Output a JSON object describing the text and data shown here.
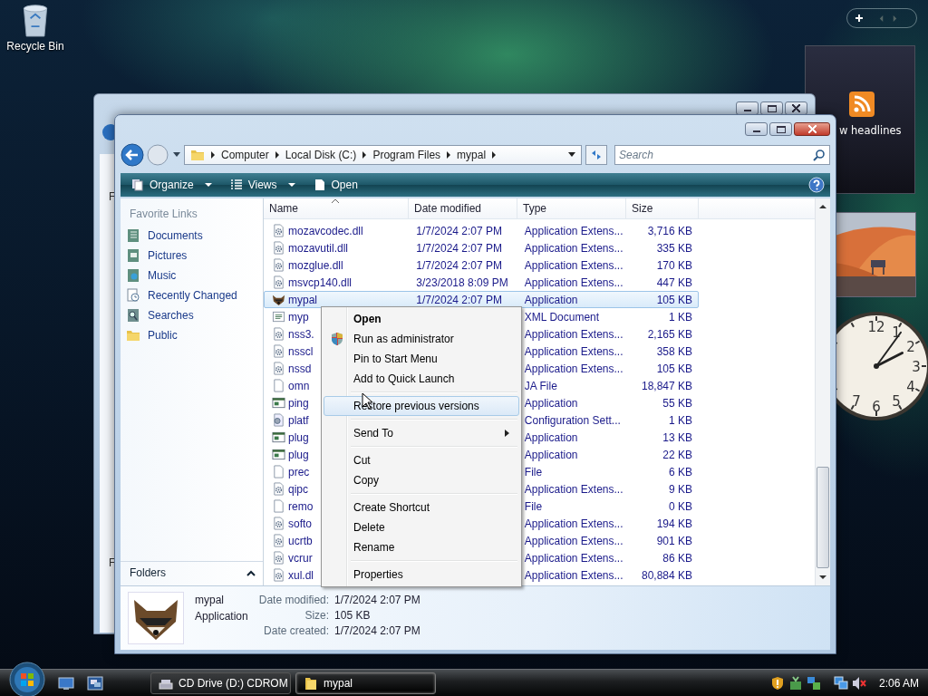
{
  "desktop": {
    "icons": [
      {
        "label": "Recycle Bin"
      }
    ]
  },
  "gadgets": {
    "feed_text": "w headlines",
    "clock": {
      "numerals": [
        "12",
        "1",
        "2",
        "3",
        "4",
        "5",
        "6",
        "7"
      ]
    }
  },
  "back_window": {
    "labels": [
      "F",
      "F"
    ]
  },
  "window": {
    "address": {
      "crumbs": [
        "Computer",
        "Local Disk (C:)",
        "Program Files",
        "mypal"
      ]
    },
    "search": {
      "placeholder": "Search"
    },
    "toolbar": [
      {
        "label": "Organize",
        "kind": "organize",
        "dropdown": true
      },
      {
        "label": "Views",
        "kind": "views",
        "dropdown": true
      },
      {
        "label": "Open",
        "kind": "open",
        "dropdown": false
      }
    ],
    "sidebar": {
      "heading": "Favorite Links",
      "items": [
        {
          "label": "Documents",
          "kind": "documents"
        },
        {
          "label": "Pictures",
          "kind": "pictures"
        },
        {
          "label": "Music",
          "kind": "music"
        },
        {
          "label": "Recently Changed",
          "kind": "recent"
        },
        {
          "label": "Searches",
          "kind": "searches"
        },
        {
          "label": "Public",
          "kind": "folder"
        }
      ],
      "folders": "Folders"
    },
    "columns": [
      {
        "label": "Name",
        "sorted": true
      },
      {
        "label": "Date modified",
        "sorted": false
      },
      {
        "label": "Type",
        "sorted": false
      },
      {
        "label": "Size",
        "sorted": false
      }
    ],
    "rows": [
      {
        "name": "mozavcodec.dll",
        "date": "1/7/2024 2:07 PM",
        "type": "Application Extens...",
        "size": "3,716 KB",
        "kind": "dll",
        "selected": false
      },
      {
        "name": "mozavutil.dll",
        "date": "1/7/2024 2:07 PM",
        "type": "Application Extens...",
        "size": "335 KB",
        "kind": "dll",
        "selected": false
      },
      {
        "name": "mozglue.dll",
        "date": "1/7/2024 2:07 PM",
        "type": "Application Extens...",
        "size": "170 KB",
        "kind": "dll",
        "selected": false
      },
      {
        "name": "msvcp140.dll",
        "date": "3/23/2018 8:09 PM",
        "type": "Application Extens...",
        "size": "447 KB",
        "kind": "dll",
        "selected": false
      },
      {
        "name": "mypal",
        "date": "1/7/2024 2:07 PM",
        "type": "Application",
        "size": "105 KB",
        "kind": "logo",
        "selected": true
      },
      {
        "name": "myp",
        "type": "XML Document",
        "size": "1 KB",
        "kind": "xml",
        "selected": false
      },
      {
        "name": "nss3.",
        "type": "Application Extens...",
        "size": "2,165 KB",
        "kind": "dll",
        "selected": false
      },
      {
        "name": "nsscl",
        "type": "Application Extens...",
        "size": "358 KB",
        "kind": "dll",
        "selected": false
      },
      {
        "name": "nssd",
        "type": "Application Extens...",
        "size": "105 KB",
        "kind": "dll",
        "selected": false
      },
      {
        "name": "omn",
        "type": "JA File",
        "size": "18,847 KB",
        "kind": "file",
        "selected": false
      },
      {
        "name": "ping",
        "type": "Application",
        "size": "55 KB",
        "kind": "app",
        "selected": false
      },
      {
        "name": "platf",
        "type": "Configuration Sett...",
        "size": "1 KB",
        "kind": "config",
        "selected": false
      },
      {
        "name": "plug",
        "type": "Application",
        "size": "13 KB",
        "kind": "app",
        "selected": false
      },
      {
        "name": "plug",
        "type": "Application",
        "size": "22 KB",
        "kind": "app",
        "selected": false
      },
      {
        "name": "prec",
        "type": "File",
        "size": "6 KB",
        "kind": "file",
        "selected": false
      },
      {
        "name": "qipc",
        "type": "Application Extens...",
        "size": "9 KB",
        "kind": "dll",
        "selected": false
      },
      {
        "name": "remo",
        "type": "File",
        "size": "0 KB",
        "kind": "file",
        "selected": false
      },
      {
        "name": "softo",
        "type": "Application Extens...",
        "size": "194 KB",
        "kind": "dll",
        "selected": false
      },
      {
        "name": "ucrtb",
        "type": "Application Extens...",
        "size": "901 KB",
        "kind": "dll",
        "selected": false
      },
      {
        "name": "vcrur",
        "type": "Application Extens...",
        "size": "86 KB",
        "kind": "dll",
        "selected": false
      },
      {
        "name": "xul.dl",
        "type": "Application Extens...",
        "size": "80,884 KB",
        "kind": "dll",
        "selected": false
      }
    ],
    "details": {
      "name": "mypal",
      "type": "Application",
      "fields": [
        {
          "label": "Date modified:",
          "value": "1/7/2024 2:07 PM"
        },
        {
          "label": "Size:",
          "value": "105 KB"
        },
        {
          "label": "Date created:",
          "value": "1/7/2024 2:07 PM"
        }
      ]
    }
  },
  "context_menu": {
    "items": [
      {
        "kind": "item",
        "label": "Open",
        "default": true,
        "shield": false,
        "submenu": false,
        "highlighted": false
      },
      {
        "kind": "item",
        "label": "Run as administrator",
        "default": false,
        "shield": true,
        "submenu": false,
        "highlighted": false
      },
      {
        "kind": "item",
        "label": "Pin to Start Menu",
        "default": false,
        "shield": false,
        "submenu": false,
        "highlighted": false
      },
      {
        "kind": "item",
        "label": "Add to Quick Launch",
        "default": false,
        "shield": false,
        "submenu": false,
        "highlighted": false
      },
      {
        "kind": "separator"
      },
      {
        "kind": "item",
        "label": "Restore previous versions",
        "default": false,
        "shield": false,
        "submenu": false,
        "highlighted": true
      },
      {
        "kind": "separator"
      },
      {
        "kind": "item",
        "label": "Send To",
        "default": false,
        "shield": false,
        "submenu": true,
        "highlighted": false
      },
      {
        "kind": "separator"
      },
      {
        "kind": "item",
        "label": "Cut",
        "default": false,
        "shield": false,
        "submenu": false,
        "highlighted": false
      },
      {
        "kind": "item",
        "label": "Copy",
        "default": false,
        "shield": false,
        "submenu": false,
        "highlighted": false
      },
      {
        "kind": "separator"
      },
      {
        "kind": "item",
        "label": "Create Shortcut",
        "default": false,
        "shield": false,
        "submenu": false,
        "highlighted": false
      },
      {
        "kind": "item",
        "label": "Delete",
        "default": false,
        "shield": false,
        "submenu": false,
        "highlighted": false
      },
      {
        "kind": "item",
        "label": "Rename",
        "default": false,
        "shield": false,
        "submenu": false,
        "highlighted": false
      },
      {
        "kind": "separator"
      },
      {
        "kind": "item",
        "label": "Properties",
        "default": false,
        "shield": false,
        "submenu": false,
        "highlighted": false
      }
    ]
  },
  "taskbar": {
    "buttons": [
      {
        "label": "CD Drive (D:) CDROM",
        "kind": "drive",
        "selected": false
      },
      {
        "label": "mypal",
        "kind": "folder",
        "selected": true
      }
    ],
    "clock": "2:06 AM"
  }
}
